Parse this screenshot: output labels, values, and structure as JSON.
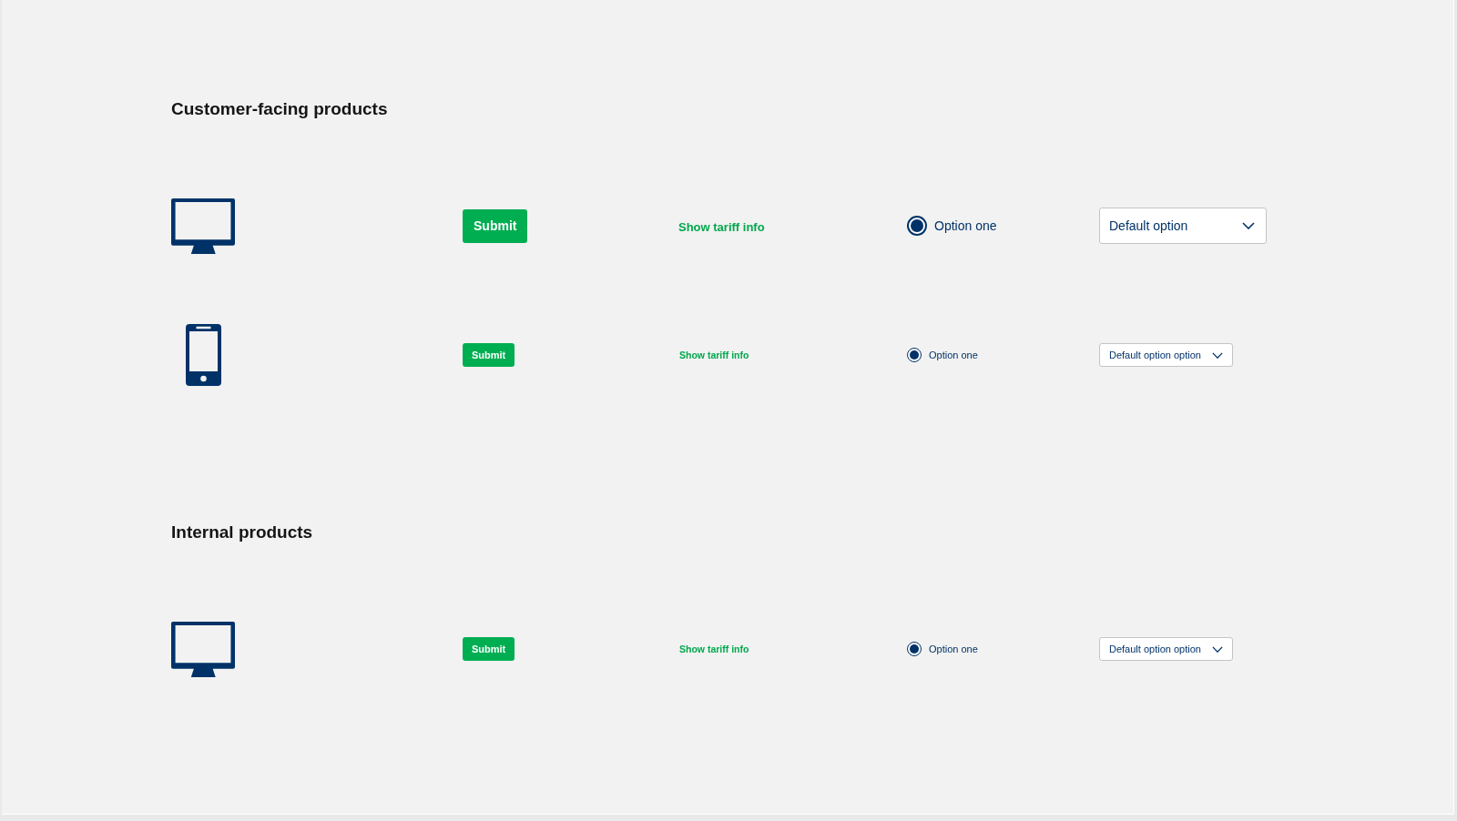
{
  "sections": [
    {
      "title": "Customer-facing products",
      "rows": [
        {
          "kind": "desktop",
          "compact": false,
          "button": "Submit",
          "link": "Show tariff info",
          "radio": {
            "label": "Option one",
            "selected": true
          },
          "select": {
            "value": "Default option"
          }
        },
        {
          "kind": "mobile",
          "compact": true,
          "button": "Submit",
          "link": "Show tariff info",
          "radio": {
            "label": "Option one",
            "selected": true
          },
          "select": {
            "value": "Default option option"
          }
        }
      ]
    },
    {
      "title": "Internal products",
      "rows": [
        {
          "kind": "desktop",
          "compact": true,
          "button": "Submit",
          "link": "Show tariff info",
          "radio": {
            "label": "Option one",
            "selected": true
          },
          "select": {
            "value": "Default option option"
          }
        }
      ]
    }
  ]
}
